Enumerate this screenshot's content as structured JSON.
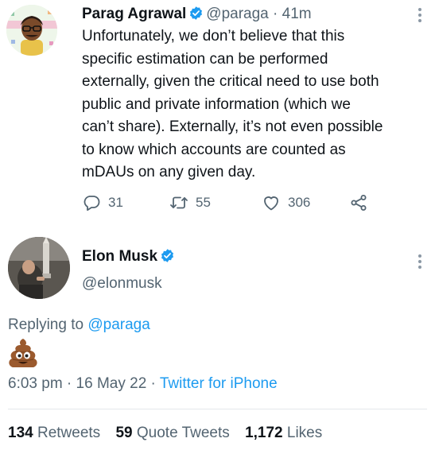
{
  "tweet": {
    "author_name": "Parag Agrawal",
    "author_handle": "@paraga",
    "time_sep": "·",
    "time": "41m",
    "text_lines": [
      "Unfortunately, we don’t believe that this",
      "specific estimation can be performed",
      "externally, given the critical need to use both",
      "public and private information (which we",
      "can’t share). Externally, it’s not even possible",
      "to know which accounts are counted as",
      "mDAUs on any given day."
    ],
    "replies": "31",
    "retweets": "55",
    "likes": "306"
  },
  "reply": {
    "author_name": "Elon Musk",
    "author_handle": "@elonmusk",
    "replying_to_label": "Replying to",
    "replying_to_handle": "@paraga",
    "content_emoji": "pile-of-poo-emoji",
    "posted_time": "6:03 pm",
    "posted_date": "16 May 22",
    "source": "Twitter for iPhone",
    "stats": {
      "retweets_count": "134",
      "retweets_label": "Retweets",
      "quote_tweets_count": "59",
      "quote_tweets_label": "Quote Tweets",
      "likes_count": "1,172",
      "likes_label": "Likes"
    }
  },
  "icons": {
    "reply": "reply-icon",
    "retweet": "retweet-icon",
    "like": "heart-icon",
    "share": "share-icon",
    "more": "more-icon",
    "verified": "verified-badge-icon"
  },
  "colors": {
    "text": "#0f1419",
    "secondary": "#536471",
    "accent": "#1d9bf0"
  }
}
